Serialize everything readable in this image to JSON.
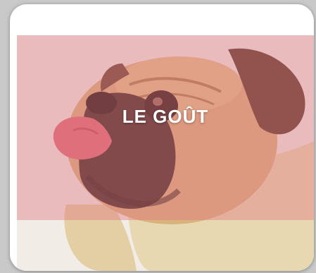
{
  "card": {
    "title": "LE GOÛT",
    "image_icon": "pug-licking-photo"
  },
  "colors": {
    "tint": "#e17882",
    "background": "#ffffff",
    "title_text": "#ffffff"
  }
}
